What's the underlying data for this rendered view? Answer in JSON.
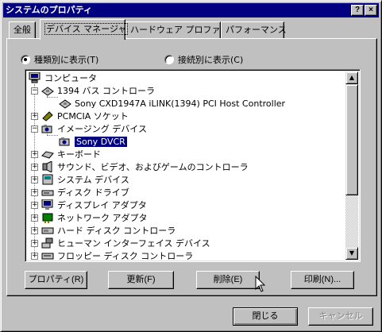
{
  "window": {
    "title": "システムのプロパティ",
    "help_label": "?",
    "close_label": "×"
  },
  "tabs": [
    {
      "label": "全般"
    },
    {
      "label": "デバイス マネージャ"
    },
    {
      "label": "ハードウェア プロファイル"
    },
    {
      "label": "パフォーマンス"
    }
  ],
  "view_options": {
    "by_type": "種類別に表示(T)",
    "by_connection": "接続別に表示(C)",
    "selected": "by_type"
  },
  "tree": {
    "items": [
      {
        "label": "コンピュータ",
        "icon": "computer-icon",
        "level": 0,
        "expander": ""
      },
      {
        "label": "1394 バス コントローラ",
        "icon": "bus-controller-icon",
        "level": 0,
        "expander": "−"
      },
      {
        "label": "Sony CXD1947A iLINK(1394) PCI Host Controller",
        "icon": "bus-controller-icon",
        "level": 1,
        "expander": ""
      },
      {
        "label": "PCMCIA ソケット",
        "icon": "pcmcia-icon",
        "level": 0,
        "expander": "+"
      },
      {
        "label": "イメージング デバイス",
        "icon": "camera-icon",
        "level": 0,
        "expander": "−"
      },
      {
        "label": "Sony DVCR",
        "icon": "camera-icon",
        "level": 1,
        "expander": "",
        "selected": true
      },
      {
        "label": "キーボード",
        "icon": "keyboard-icon",
        "level": 0,
        "expander": "+"
      },
      {
        "label": "サウンド、ビデオ、およびゲームのコントローラ",
        "icon": "sound-icon",
        "level": 0,
        "expander": "+"
      },
      {
        "label": "システム デバイス",
        "icon": "system-device-icon",
        "level": 0,
        "expander": "+"
      },
      {
        "label": "ディスク ドライブ",
        "icon": "disk-drive-icon",
        "level": 0,
        "expander": "+"
      },
      {
        "label": "ディスプレイ アダプタ",
        "icon": "display-adapter-icon",
        "level": 0,
        "expander": "+"
      },
      {
        "label": "ネットワーク アダプタ",
        "icon": "network-adapter-icon",
        "level": 0,
        "expander": "+"
      },
      {
        "label": "ハード ディスク コントローラ",
        "icon": "hdd-controller-icon",
        "level": 0,
        "expander": "+"
      },
      {
        "label": "ヒューマン インターフェイス デバイス",
        "icon": "hid-icon",
        "level": 0,
        "expander": "+"
      },
      {
        "label": "フロッピー ディスク コントローラ",
        "icon": "floppy-controller-icon",
        "level": 0,
        "expander": "+"
      }
    ]
  },
  "panel_buttons": {
    "properties": "プロパティ(R)",
    "refresh": "更新(F)",
    "remove": "削除(E)",
    "print": "印刷(N)..."
  },
  "dialog_buttons": {
    "close": "閉じる",
    "cancel": "キャンセル"
  },
  "colors": {
    "titlebar": "#000080",
    "face": "#c0c0c0",
    "selection": "#000080"
  }
}
